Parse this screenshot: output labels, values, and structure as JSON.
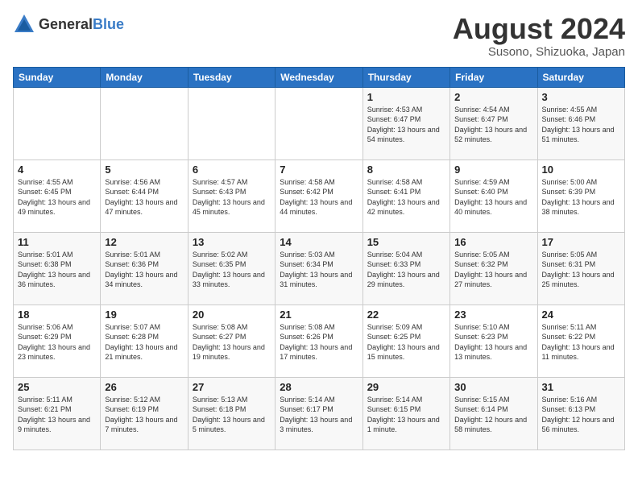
{
  "header": {
    "logo_general": "General",
    "logo_blue": "Blue",
    "title": "August 2024",
    "subtitle": "Susono, Shizuoka, Japan"
  },
  "days_of_week": [
    "Sunday",
    "Monday",
    "Tuesday",
    "Wednesday",
    "Thursday",
    "Friday",
    "Saturday"
  ],
  "weeks": [
    [
      {
        "day": "",
        "detail": ""
      },
      {
        "day": "",
        "detail": ""
      },
      {
        "day": "",
        "detail": ""
      },
      {
        "day": "",
        "detail": ""
      },
      {
        "day": "1",
        "detail": "Sunrise: 4:53 AM\nSunset: 6:47 PM\nDaylight: 13 hours\nand 54 minutes."
      },
      {
        "day": "2",
        "detail": "Sunrise: 4:54 AM\nSunset: 6:47 PM\nDaylight: 13 hours\nand 52 minutes."
      },
      {
        "day": "3",
        "detail": "Sunrise: 4:55 AM\nSunset: 6:46 PM\nDaylight: 13 hours\nand 51 minutes."
      }
    ],
    [
      {
        "day": "4",
        "detail": "Sunrise: 4:55 AM\nSunset: 6:45 PM\nDaylight: 13 hours\nand 49 minutes."
      },
      {
        "day": "5",
        "detail": "Sunrise: 4:56 AM\nSunset: 6:44 PM\nDaylight: 13 hours\nand 47 minutes."
      },
      {
        "day": "6",
        "detail": "Sunrise: 4:57 AM\nSunset: 6:43 PM\nDaylight: 13 hours\nand 45 minutes."
      },
      {
        "day": "7",
        "detail": "Sunrise: 4:58 AM\nSunset: 6:42 PM\nDaylight: 13 hours\nand 44 minutes."
      },
      {
        "day": "8",
        "detail": "Sunrise: 4:58 AM\nSunset: 6:41 PM\nDaylight: 13 hours\nand 42 minutes."
      },
      {
        "day": "9",
        "detail": "Sunrise: 4:59 AM\nSunset: 6:40 PM\nDaylight: 13 hours\nand 40 minutes."
      },
      {
        "day": "10",
        "detail": "Sunrise: 5:00 AM\nSunset: 6:39 PM\nDaylight: 13 hours\nand 38 minutes."
      }
    ],
    [
      {
        "day": "11",
        "detail": "Sunrise: 5:01 AM\nSunset: 6:38 PM\nDaylight: 13 hours\nand 36 minutes."
      },
      {
        "day": "12",
        "detail": "Sunrise: 5:01 AM\nSunset: 6:36 PM\nDaylight: 13 hours\nand 34 minutes."
      },
      {
        "day": "13",
        "detail": "Sunrise: 5:02 AM\nSunset: 6:35 PM\nDaylight: 13 hours\nand 33 minutes."
      },
      {
        "day": "14",
        "detail": "Sunrise: 5:03 AM\nSunset: 6:34 PM\nDaylight: 13 hours\nand 31 minutes."
      },
      {
        "day": "15",
        "detail": "Sunrise: 5:04 AM\nSunset: 6:33 PM\nDaylight: 13 hours\nand 29 minutes."
      },
      {
        "day": "16",
        "detail": "Sunrise: 5:05 AM\nSunset: 6:32 PM\nDaylight: 13 hours\nand 27 minutes."
      },
      {
        "day": "17",
        "detail": "Sunrise: 5:05 AM\nSunset: 6:31 PM\nDaylight: 13 hours\nand 25 minutes."
      }
    ],
    [
      {
        "day": "18",
        "detail": "Sunrise: 5:06 AM\nSunset: 6:29 PM\nDaylight: 13 hours\nand 23 minutes."
      },
      {
        "day": "19",
        "detail": "Sunrise: 5:07 AM\nSunset: 6:28 PM\nDaylight: 13 hours\nand 21 minutes."
      },
      {
        "day": "20",
        "detail": "Sunrise: 5:08 AM\nSunset: 6:27 PM\nDaylight: 13 hours\nand 19 minutes."
      },
      {
        "day": "21",
        "detail": "Sunrise: 5:08 AM\nSunset: 6:26 PM\nDaylight: 13 hours\nand 17 minutes."
      },
      {
        "day": "22",
        "detail": "Sunrise: 5:09 AM\nSunset: 6:25 PM\nDaylight: 13 hours\nand 15 minutes."
      },
      {
        "day": "23",
        "detail": "Sunrise: 5:10 AM\nSunset: 6:23 PM\nDaylight: 13 hours\nand 13 minutes."
      },
      {
        "day": "24",
        "detail": "Sunrise: 5:11 AM\nSunset: 6:22 PM\nDaylight: 13 hours\nand 11 minutes."
      }
    ],
    [
      {
        "day": "25",
        "detail": "Sunrise: 5:11 AM\nSunset: 6:21 PM\nDaylight: 13 hours\nand 9 minutes."
      },
      {
        "day": "26",
        "detail": "Sunrise: 5:12 AM\nSunset: 6:19 PM\nDaylight: 13 hours\nand 7 minutes."
      },
      {
        "day": "27",
        "detail": "Sunrise: 5:13 AM\nSunset: 6:18 PM\nDaylight: 13 hours\nand 5 minutes."
      },
      {
        "day": "28",
        "detail": "Sunrise: 5:14 AM\nSunset: 6:17 PM\nDaylight: 13 hours\nand 3 minutes."
      },
      {
        "day": "29",
        "detail": "Sunrise: 5:14 AM\nSunset: 6:15 PM\nDaylight: 13 hours\nand 1 minute."
      },
      {
        "day": "30",
        "detail": "Sunrise: 5:15 AM\nSunset: 6:14 PM\nDaylight: 12 hours\nand 58 minutes."
      },
      {
        "day": "31",
        "detail": "Sunrise: 5:16 AM\nSunset: 6:13 PM\nDaylight: 12 hours\nand 56 minutes."
      }
    ]
  ]
}
